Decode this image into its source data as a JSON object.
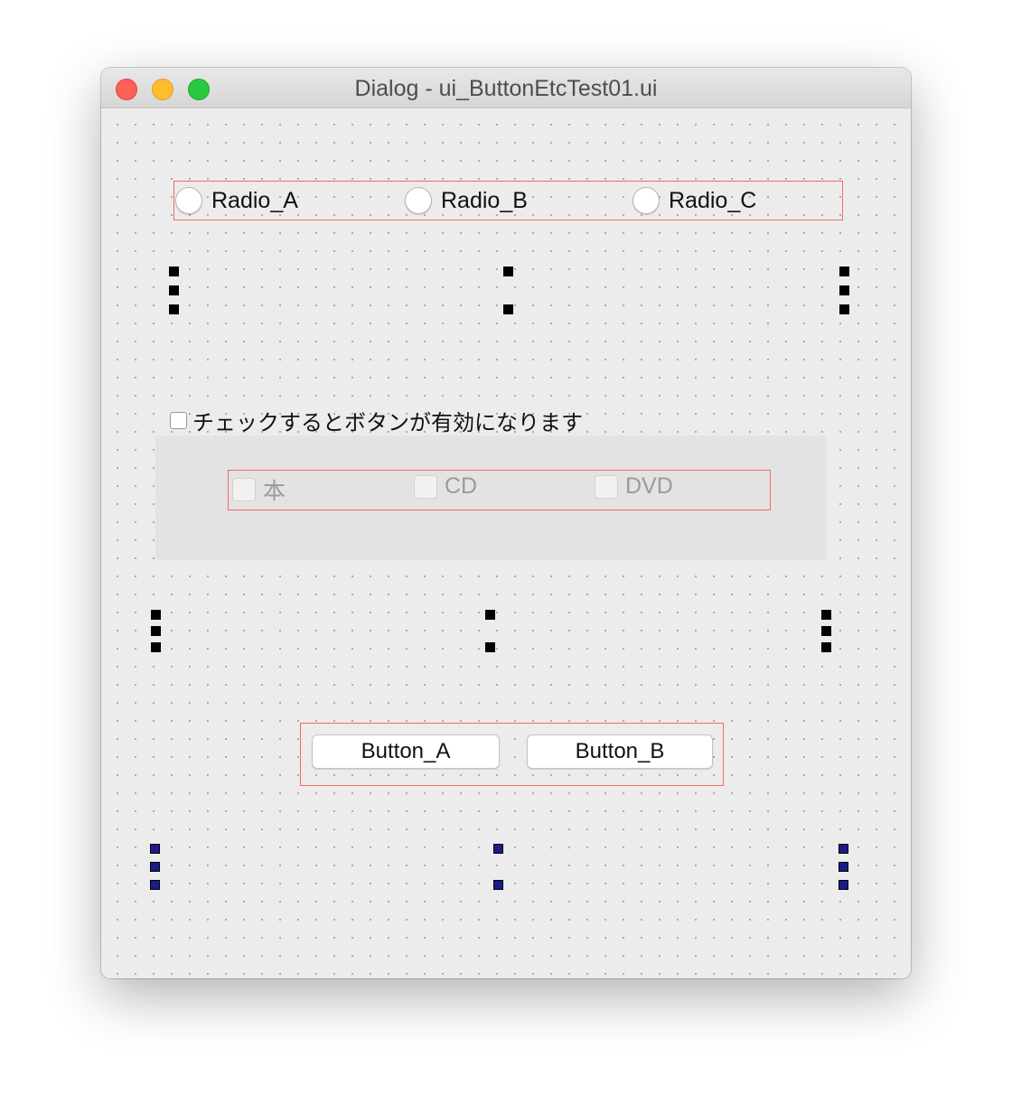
{
  "window": {
    "title": "Dialog - ui_ButtonEtcTest01.ui"
  },
  "radios": [
    {
      "label": "Radio_A",
      "checked": false
    },
    {
      "label": "Radio_B",
      "checked": false
    },
    {
      "label": "Radio_C",
      "checked": false
    }
  ],
  "enable_checkbox": {
    "label": "チェックするとボタンが有効になります",
    "checked": false
  },
  "disabled_checkboxes": [
    {
      "label": "本",
      "checked": false,
      "enabled": false
    },
    {
      "label": "CD",
      "checked": false,
      "enabled": false
    },
    {
      "label": "DVD",
      "checked": false,
      "enabled": false
    }
  ],
  "buttons": [
    {
      "label": "Button_A"
    },
    {
      "label": "Button_B"
    }
  ],
  "colors": {
    "layout_outline": "#f06a6a",
    "close": "#fe5f57",
    "minimize": "#febc2e",
    "maximize": "#28c840",
    "selected_spacer": "#1b1b8a"
  }
}
